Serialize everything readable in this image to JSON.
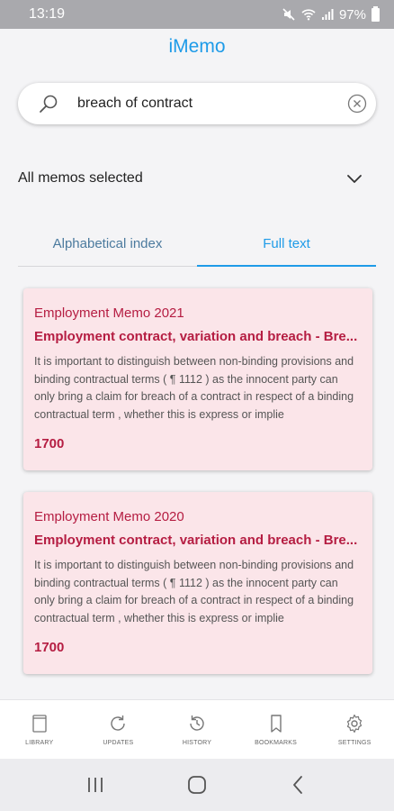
{
  "status_bar": {
    "time": "13:19",
    "battery": "97%",
    "icons": [
      "mute-icon",
      "wifi-icon",
      "signal-icon",
      "battery-icon"
    ]
  },
  "header": {
    "title": "iMemo"
  },
  "search": {
    "value": "breach of contract",
    "placeholder": ""
  },
  "memo_selector": {
    "label": "All memos selected"
  },
  "tabs": [
    {
      "label": "Alphabetical index",
      "active": false
    },
    {
      "label": "Full text",
      "active": true
    }
  ],
  "results": [
    {
      "memo": "Employment Memo 2021",
      "heading": "Employment contract, variation and breach - Bre...",
      "snippet": "It is important to distinguish between non-binding provisions and binding contractual terms ( ¶ 1112 ) as the innocent party can only bring a claim for breach of a contract in respect of a binding contractual term , whether this is express or implie",
      "number": "1700"
    },
    {
      "memo": "Employment Memo 2020",
      "heading": "Employment contract, variation and breach - Bre...",
      "snippet": "It is important to distinguish between non-binding provisions and binding contractual terms ( ¶ 1112 ) as the innocent party can only bring a claim for breach of a contract in respect of a binding contractual term , whether this is express or implie",
      "number": "1700"
    }
  ],
  "bottom_nav": [
    {
      "label": "LIBRARY",
      "icon": "library-icon"
    },
    {
      "label": "UPDATES",
      "icon": "updates-icon"
    },
    {
      "label": "HISTORY",
      "icon": "history-icon"
    },
    {
      "label": "BOOKMARKS",
      "icon": "bookmark-icon"
    },
    {
      "label": "SETTINGS",
      "icon": "gear-icon"
    }
  ],
  "colors": {
    "accent": "#1e9be8",
    "card_bg": "#fbe5e9",
    "card_text": "#b51d42"
  }
}
